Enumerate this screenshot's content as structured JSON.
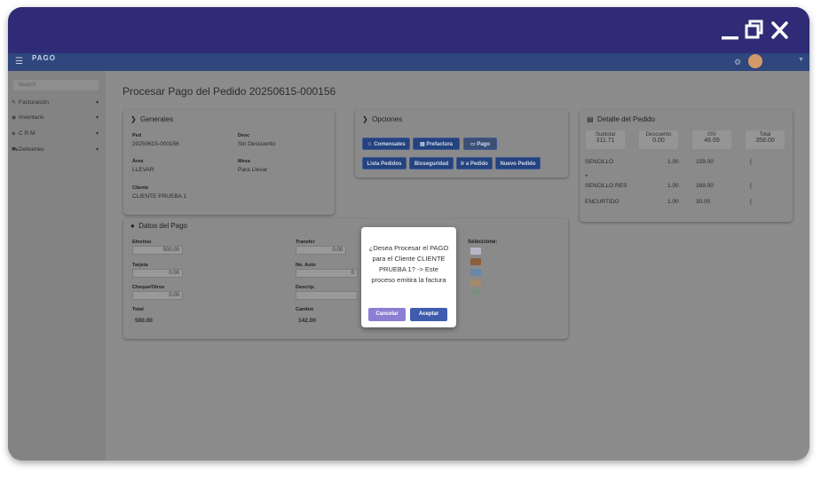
{
  "app": {
    "logo_text": "PAGO"
  },
  "window_controls": {
    "minimize": "minimize-icon",
    "restore": "restore-icon",
    "close": "close-icon"
  },
  "sidebar": {
    "search_placeholder": "Search",
    "items": [
      {
        "label": "Facturación",
        "icon": "invoice-icon"
      },
      {
        "label": "Inventario",
        "icon": "inventory-icon"
      },
      {
        "label": "C R M",
        "icon": "crm-icon"
      },
      {
        "label": "Deliveries",
        "icon": "truck-icon"
      }
    ]
  },
  "page": {
    "title": "Procesar Pago del Pedido 20250615-000156"
  },
  "generales": {
    "title": "Generales",
    "ped_label": "Ped",
    "ped_value": "20250615-000156",
    "desc_label": "Desc",
    "desc_value": "Sin Descuento",
    "area_label": "Área",
    "area_value": "LLEVAR",
    "mesa_label": "Mesa",
    "mesa_value": "Para Llevar",
    "cliente_label": "Cliente",
    "cliente_value": "CLIENTE PRUEBA 1"
  },
  "opciones": {
    "title": "Opciones",
    "buttons": [
      "Comensales",
      "Prefactura",
      "Pago",
      "Lista Pedidos",
      "Bioseguridad",
      "Ir a Pedido",
      "Nuevo Pedido"
    ]
  },
  "detalle": {
    "title": "Detalle del Pedido",
    "summary": [
      {
        "label": "Subtotal",
        "value": "311.71"
      },
      {
        "label": "Descuento",
        "value": "0.00"
      },
      {
        "label": "ISV",
        "value": "46.69"
      },
      {
        "label": "Total",
        "value": "358.00"
      }
    ],
    "rows": [
      {
        "name": "SENCILLO",
        "qty": "1.00",
        "price": "159.00",
        "extra": "("
      },
      {
        "name": "SENCILLO RES",
        "qty": "1.00",
        "price": "169.00",
        "extra": "("
      },
      {
        "name": "ENCURTIDO",
        "qty": "1.00",
        "price": "30.00",
        "extra": "("
      }
    ],
    "row_note": "+"
  },
  "pago": {
    "title": "Datos del Pago",
    "efectivo_label": "Efectivo",
    "efectivo_value": "500.00",
    "tarjeta_label": "Tarjeta",
    "tarjeta_value": "0.00",
    "cheque_label": "Cheque/Otros",
    "cheque_value": "0.00",
    "total_label": "Total",
    "total_value": "500.00",
    "transfer_label": "Transfer",
    "transfer_value": "0.00",
    "noauto_label": "No. Auto",
    "noauto_value": "0",
    "descrip_label": "Descrip.",
    "cambio_label": "Cambio",
    "cambio_value": "142.00",
    "selection_label": "Seleccione:",
    "payment_icons": [
      "visa-icon",
      "mastercard-icon",
      "amex-icon",
      "discover-icon",
      "cash-icon"
    ]
  },
  "modal": {
    "message": "¿Desea Procesar el PAGO para el Cliente CLIENTE PRUEBA 1? -> Este proceso emitira la factura",
    "cancel_label": "Cancelar",
    "accept_label": "Aceptar"
  },
  "colors": {
    "titlebar": "#2f2b76",
    "appbar": "#2f477d",
    "button": "#23427e",
    "cancel_button": "#8b7fd4",
    "accept_button": "#3f5cae"
  }
}
